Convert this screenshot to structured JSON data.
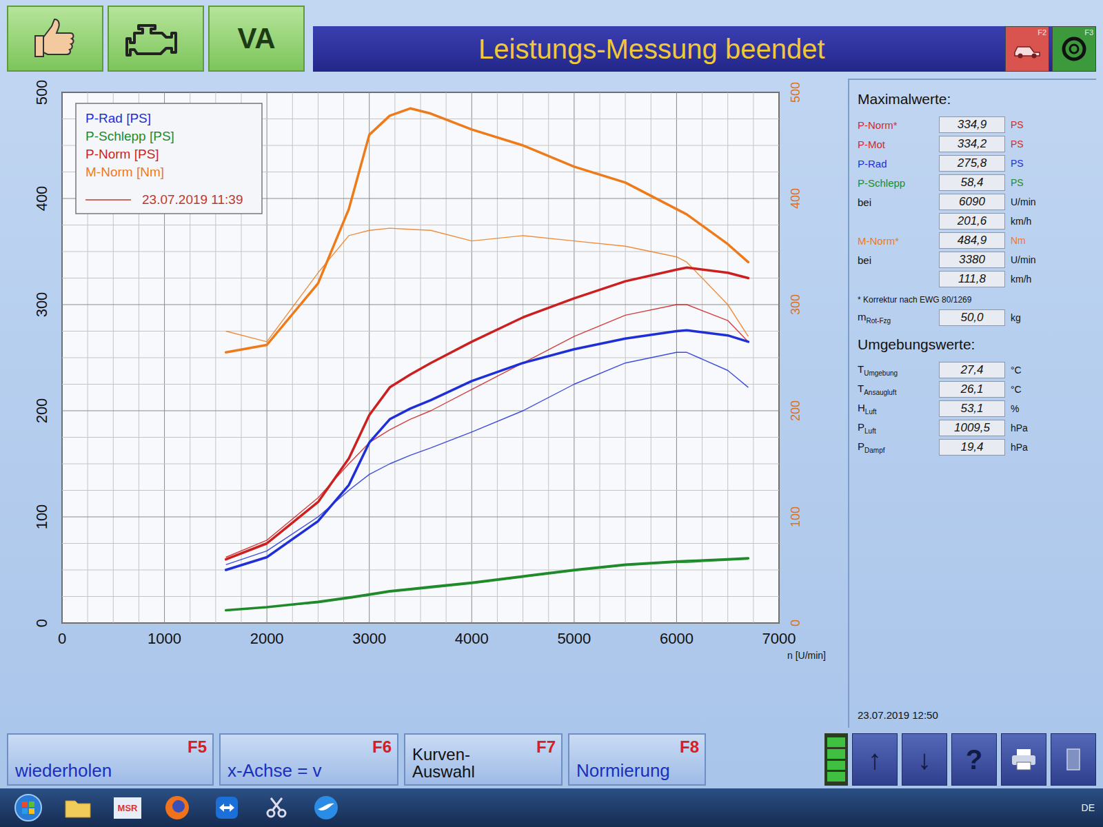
{
  "toolbar": {
    "buttons": [
      {
        "kind": "thumb"
      },
      {
        "kind": "engine"
      },
      {
        "kind": "text",
        "label": "VA"
      }
    ]
  },
  "title": "Leistungs-Messung beendet",
  "corner_buttons": [
    {
      "kind": "car",
      "key": "F2",
      "color": "#d9534f"
    },
    {
      "kind": "wheel",
      "key": "F3",
      "color": "#3c9a3c"
    }
  ],
  "chart": {
    "x_ticks": [
      "0",
      "1000",
      "2000",
      "3000",
      "4000",
      "5000",
      "6000",
      "7000"
    ],
    "left_ticks": [
      "0",
      "100",
      "200",
      "300",
      "400",
      "500"
    ],
    "right_ticks": [
      "0",
      "100",
      "200",
      "300",
      "400",
      "500"
    ],
    "x_unit": "n [U/min]",
    "rpm": [
      1600,
      2000,
      2500,
      2800,
      3000,
      3200,
      3400,
      3600,
      4000,
      4500,
      5000,
      5500,
      6000,
      6100,
      6500,
      6700
    ],
    "series": [
      {
        "name": "P-Rad [PS]",
        "color": "#1f2fd6",
        "values": [
          50,
          62,
          96,
          130,
          170,
          192,
          202,
          210,
          228,
          245,
          258,
          268,
          275,
          275.8,
          271,
          265
        ],
        "compare": [
          55,
          68,
          100,
          125,
          140,
          150,
          158,
          165,
          180,
          200,
          225,
          245,
          255,
          255,
          238,
          222
        ]
      },
      {
        "name": "P-Schlepp [PS]",
        "color": "#1f8a2a",
        "values": [
          12,
          15,
          20,
          24,
          27,
          30,
          32,
          34,
          38,
          44,
          50,
          55,
          58,
          58.4,
          60,
          61
        ],
        "compare": [
          12,
          15,
          19,
          23,
          26,
          29,
          31,
          33,
          37,
          43,
          49,
          54,
          57,
          57,
          59,
          60
        ]
      },
      {
        "name": "P-Norm [PS]",
        "color": "#cc1f1f",
        "values": [
          60,
          75,
          114,
          155,
          196,
          222,
          234,
          245,
          265,
          288,
          306,
          322,
          333,
          334.9,
          330,
          325
        ],
        "compare": [
          62,
          78,
          118,
          150,
          170,
          182,
          192,
          200,
          220,
          245,
          270,
          290,
          300,
          300,
          285,
          265
        ]
      },
      {
        "name": "M-Norm [Nm]",
        "color": "#ee7a1a",
        "values": [
          255,
          262,
          320,
          390,
          460,
          478,
          484.9,
          480,
          465,
          450,
          430,
          415,
          390,
          385,
          357,
          340
        ],
        "compare": [
          275,
          265,
          330,
          365,
          370,
          372,
          371,
          370,
          360,
          365,
          360,
          355,
          345,
          340,
          300,
          270
        ]
      }
    ],
    "compare": {
      "label": "23.07.2019 11:39",
      "color": "#c0392b"
    }
  },
  "maxima": {
    "title": "Maximalwerte:",
    "rows": [
      {
        "label": "P-Norm*",
        "value": "334,9",
        "unit": "PS",
        "color": "#d42a2a"
      },
      {
        "label": "P-Mot",
        "value": "334,2",
        "unit": "PS",
        "color": "#d42a2a"
      },
      {
        "label": "P-Rad",
        "value": "275,8",
        "unit": "PS",
        "color": "#1f2fd6"
      },
      {
        "label": "P-Schlepp",
        "value": "58,4",
        "unit": "PS",
        "color": "#1f8a2a"
      },
      {
        "label": "bei",
        "value": "6090",
        "unit": "U/min",
        "color": "#111111"
      },
      {
        "label": "",
        "value": "201,6",
        "unit": "km/h",
        "color": "#111111"
      },
      {
        "label": "M-Norm*",
        "value": "484,9",
        "unit": "Nm",
        "color": "#ee7a1a"
      },
      {
        "label": "bei",
        "value": "3380",
        "unit": "U/min",
        "color": "#111111"
      },
      {
        "label": "",
        "value": "111,8",
        "unit": "km/h",
        "color": "#111111"
      }
    ],
    "note": "* Korrektur nach EWG 80/1269",
    "mass": {
      "label": "m",
      "sub": "Rot-Fzg",
      "value": "50,0",
      "unit": "kg"
    }
  },
  "ambient": {
    "title": "Umgebungswerte:",
    "rows": [
      {
        "label": "T",
        "sub": "Umgebung",
        "value": "27,4",
        "unit": "°C"
      },
      {
        "label": "T",
        "sub": "Ansaugluft",
        "value": "26,1",
        "unit": "°C"
      },
      {
        "label": "H",
        "sub": "Luft",
        "value": "53,1",
        "unit": "%"
      },
      {
        "label": "P",
        "sub": "Luft",
        "value": "1009,5",
        "unit": "hPa"
      },
      {
        "label": "P",
        "sub": "Dampf",
        "value": "19,4",
        "unit": "hPa"
      }
    ]
  },
  "timestamp": "23.07.2019 12:50",
  "fkeys": [
    {
      "lines": [
        "wiederholen"
      ],
      "key": "F5"
    },
    {
      "lines": [
        "x-Achse = v"
      ],
      "key": "F6"
    },
    {
      "lines": [
        "Kurven-",
        "Auswahl"
      ],
      "key": "F7"
    },
    {
      "lines": [
        "Normierung"
      ],
      "key": "F8"
    }
  ],
  "nav_buttons": [
    {
      "kind": "indicator"
    },
    {
      "kind": "up",
      "label": "↑"
    },
    {
      "kind": "down",
      "label": "↓"
    },
    {
      "kind": "help",
      "label": "?"
    },
    {
      "kind": "print"
    },
    {
      "kind": "exit"
    }
  ],
  "taskbar": {
    "apps": [
      {
        "kind": "start"
      },
      {
        "kind": "folder"
      },
      {
        "kind": "msr",
        "label": "MSR"
      },
      {
        "kind": "firefox"
      },
      {
        "kind": "teamviewer"
      },
      {
        "kind": "snip"
      },
      {
        "kind": "bird"
      }
    ],
    "tray": {
      "lang": "DE"
    }
  }
}
